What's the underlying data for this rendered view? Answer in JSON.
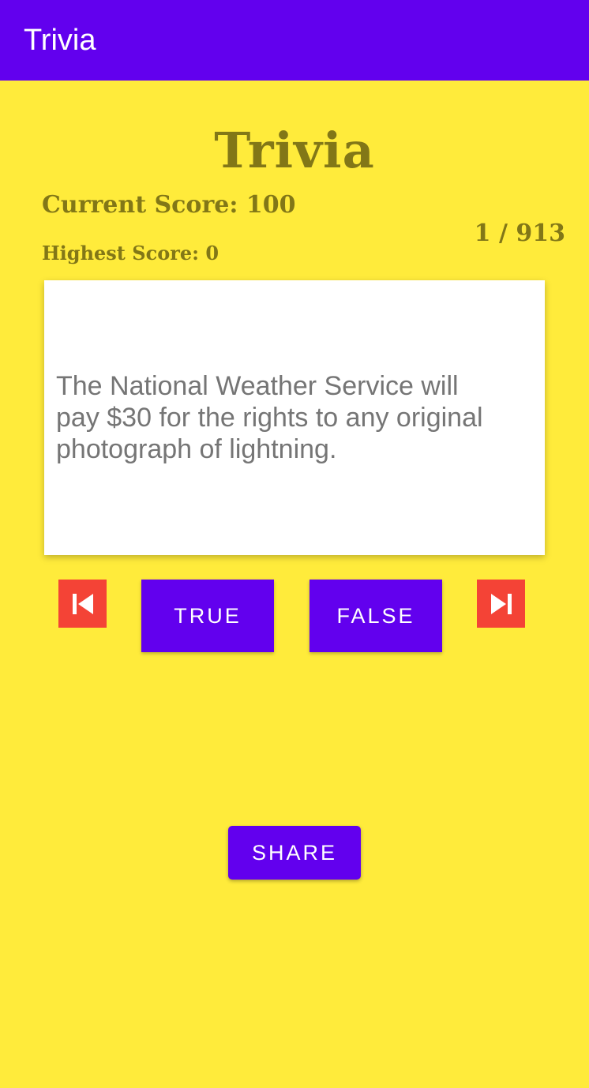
{
  "app_bar": {
    "title": "Trivia"
  },
  "screen": {
    "heading": "Trivia",
    "current_score": "Current Score: 100",
    "highest_score": "Highest Score: 0",
    "counter": "1 / 913",
    "question": "The National Weather Service will pay $30 for the rights to any original photograph of lightning."
  },
  "buttons": {
    "true_label": "TRUE",
    "false_label": "FALSE",
    "share_label": "SHARE",
    "prev_icon": "skip-previous-icon",
    "next_icon": "skip-next-icon"
  },
  "colors": {
    "app_bar": "#6200ee",
    "background": "#ffeb3b",
    "score_text": "#827717",
    "nav_button": "#f44336",
    "primary_button": "#6200ee"
  }
}
